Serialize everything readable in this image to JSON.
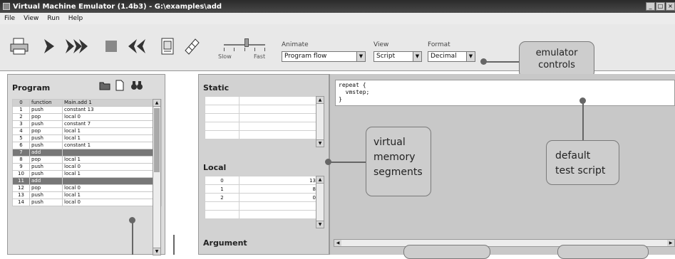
{
  "window": {
    "title": "Virtual Machine Emulator (1.4b3) - G:\\examples\\add",
    "buttons": [
      "_",
      "□",
      "×"
    ]
  },
  "menu": {
    "items": [
      "File",
      "View",
      "Run",
      "Help"
    ]
  },
  "toolbar": {
    "icons": [
      "printer-icon",
      "single-step-icon",
      "run-icon",
      "stop-icon",
      "reset-icon",
      "load-script-icon",
      "breakpoint-icon"
    ],
    "speed": {
      "slow_label": "Slow",
      "fast_label": "Fast",
      "level": 0.55
    },
    "animate": {
      "label": "Animate",
      "value": "Program flow"
    },
    "view": {
      "label": "View",
      "value": "Script"
    },
    "format": {
      "label": "Format",
      "value": "Decimal"
    }
  },
  "program": {
    "title": "Program",
    "rows": [
      {
        "n": "0",
        "cmd": "function",
        "arg": "Main.add 1"
      },
      {
        "n": "1",
        "cmd": "push",
        "arg": "constant 13"
      },
      {
        "n": "2",
        "cmd": "pop",
        "arg": "local 0"
      },
      {
        "n": "3",
        "cmd": "push",
        "arg": "constant 7"
      },
      {
        "n": "4",
        "cmd": "pop",
        "arg": "local 1"
      },
      {
        "n": "5",
        "cmd": "push",
        "arg": "local 1"
      },
      {
        "n": "6",
        "cmd": "push",
        "arg": "constant 1"
      },
      {
        "n": "7",
        "cmd": "add",
        "arg": ""
      },
      {
        "n": "8",
        "cmd": "pop",
        "arg": "local 1"
      },
      {
        "n": "9",
        "cmd": "push",
        "arg": "local 0"
      },
      {
        "n": "10",
        "cmd": "push",
        "arg": "local 1"
      },
      {
        "n": "11",
        "cmd": "add",
        "arg": ""
      },
      {
        "n": "12",
        "cmd": "pop",
        "arg": "local 0"
      },
      {
        "n": "13",
        "cmd": "push",
        "arg": "local 1"
      },
      {
        "n": "14",
        "cmd": "push",
        "arg": "local 0"
      }
    ]
  },
  "segments": {
    "static_title": "Static",
    "local_title": "Local",
    "argument_title": "Argument",
    "local_rows": [
      {
        "addr": "0",
        "value": "13"
      },
      {
        "addr": "1",
        "value": "8"
      },
      {
        "addr": "2",
        "value": "0"
      }
    ]
  },
  "script": {
    "text": "repeat {\n  vmstep;\n}"
  },
  "callouts": {
    "emulator_controls": "emulator\ncontrols",
    "virtual_memory": "virtual\nmemory\nsegments",
    "default_test_script": "default\ntest script"
  },
  "colors": {
    "highlight_row": "#777777",
    "callout_fill": "#cdcdcd",
    "panel_bg": "#d9d9d9"
  }
}
